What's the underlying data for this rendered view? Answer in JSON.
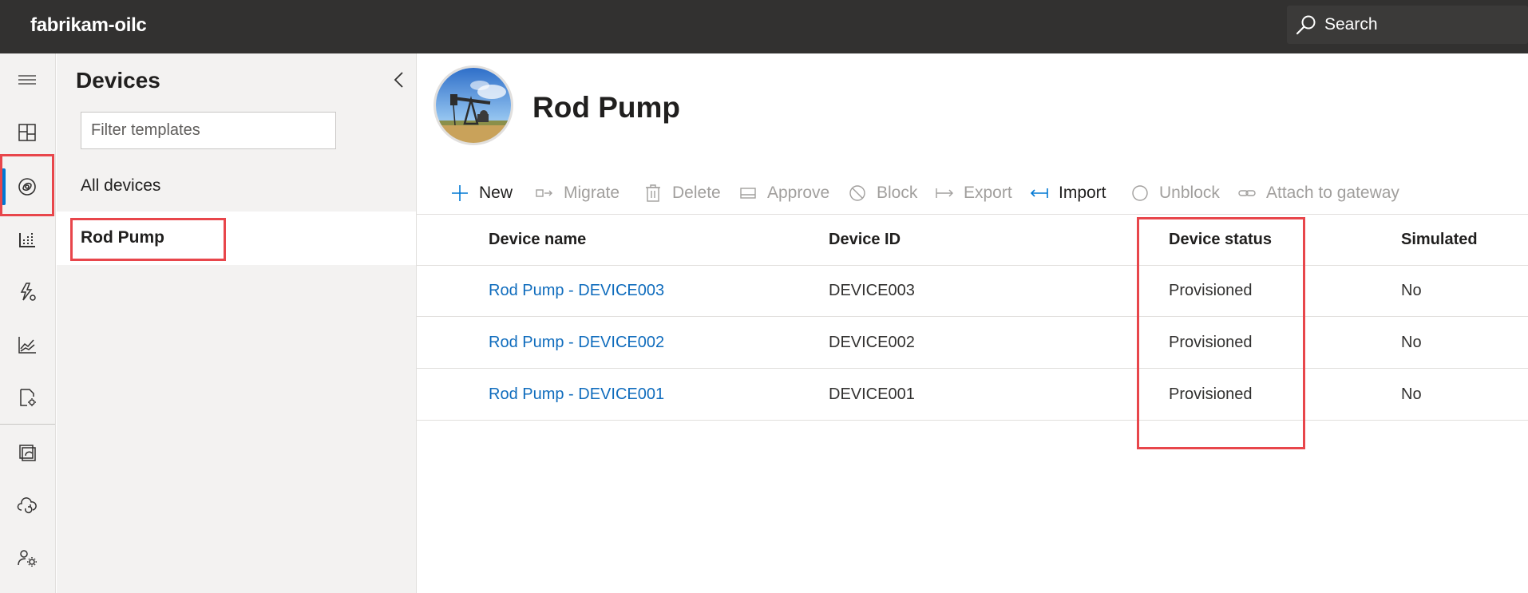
{
  "app": {
    "name": "fabrikam-oilc"
  },
  "search": {
    "label": "Search"
  },
  "rail": {
    "items": [
      "menu-icon",
      "dashboard-icon",
      "devices-icon",
      "device-groups-icon",
      "rules-icon",
      "analytics-icon",
      "jobs-icon",
      "device-templates-icon",
      "data-export-icon",
      "administration-icon"
    ],
    "active": "devices-icon"
  },
  "panel": {
    "title": "Devices",
    "filter_placeholder": "Filter templates",
    "nav": {
      "all": "All devices",
      "selected": "Rod Pump"
    }
  },
  "main": {
    "title": "Rod Pump",
    "toolbar": [
      {
        "label": "New",
        "icon": "plus-icon",
        "enabled": true
      },
      {
        "label": "Migrate",
        "icon": "migrate-icon",
        "enabled": false
      },
      {
        "label": "Delete",
        "icon": "trash-icon",
        "enabled": false
      },
      {
        "label": "Approve",
        "icon": "approve-icon",
        "enabled": false
      },
      {
        "label": "Block",
        "icon": "block-icon",
        "enabled": false
      },
      {
        "label": "Export",
        "icon": "export-icon",
        "enabled": false
      },
      {
        "label": "Import",
        "icon": "import-icon",
        "enabled": true
      },
      {
        "label": "Unblock",
        "icon": "unblock-icon",
        "enabled": false
      },
      {
        "label": "Attach to gateway",
        "icon": "link-icon",
        "enabled": false
      }
    ],
    "table": {
      "columns": [
        "Device name",
        "Device ID",
        "Device status",
        "Simulated"
      ],
      "rows": [
        {
          "name": "Rod Pump - DEVICE003",
          "id": "DEVICE003",
          "status": "Provisioned",
          "simulated": "No"
        },
        {
          "name": "Rod Pump - DEVICE002",
          "id": "DEVICE002",
          "status": "Provisioned",
          "simulated": "No"
        },
        {
          "name": "Rod Pump - DEVICE001",
          "id": "DEVICE001",
          "status": "Provisioned",
          "simulated": "No"
        }
      ]
    }
  },
  "colors": {
    "topbar": "#323130",
    "accent": "#0078d4",
    "link": "#0f6cbd",
    "highlight": "#e8464b"
  }
}
